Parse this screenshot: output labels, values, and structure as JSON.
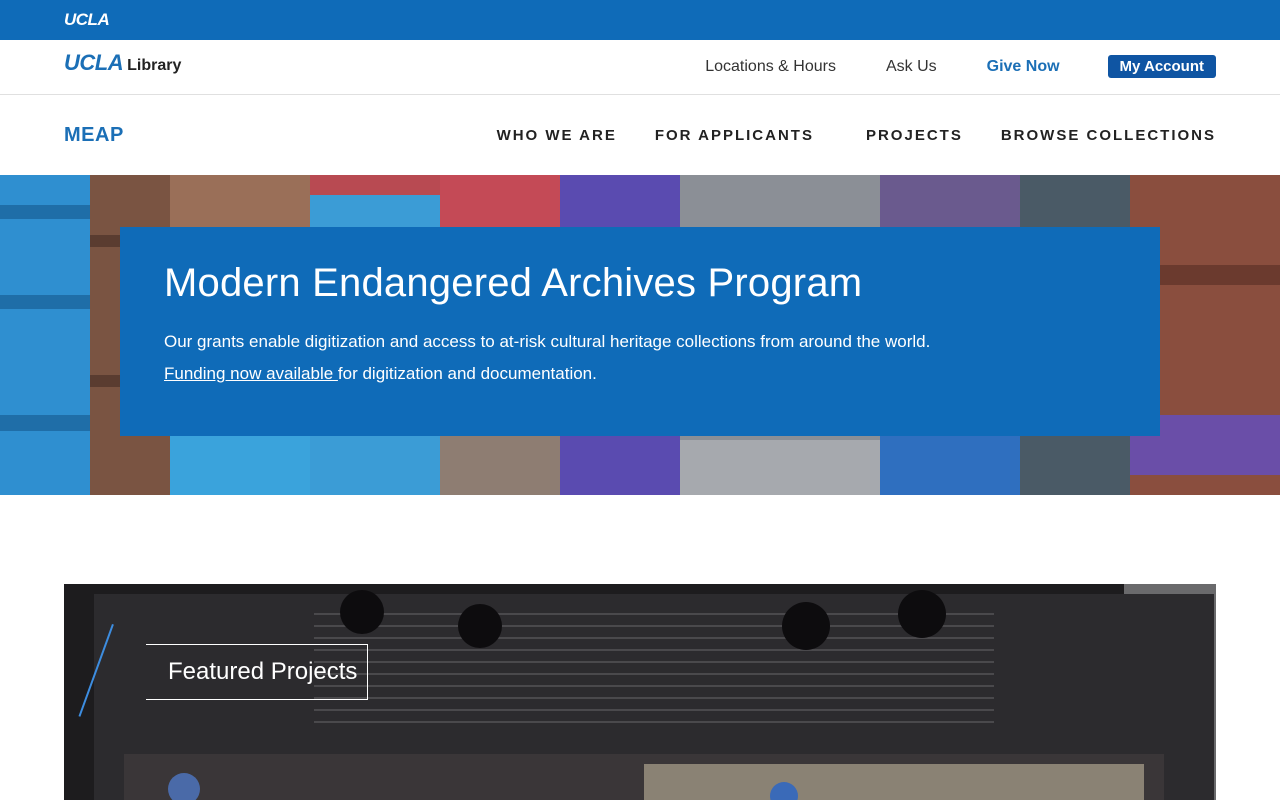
{
  "ucla_bar": {
    "brand": "UCLA"
  },
  "library_header": {
    "logo_ucla": "UCLA",
    "logo_library": "Library",
    "links": [
      "Locations & Hours",
      "Ask Us",
      "Give Now"
    ],
    "account_label": "My Account"
  },
  "site_header": {
    "title": "MEAP",
    "nav": [
      "WHO WE ARE",
      "FOR APPLICANTS",
      "PROJECTS",
      "BROWSE COLLECTIONS"
    ]
  },
  "hero": {
    "heading": "Modern Endangered Archives Program",
    "description": "Our grants enable digitization and access to at-risk cultural heritage collections from around the world.",
    "funding_link": "Funding now available ",
    "funding_suffix": "for digitization and documentation."
  },
  "featured": {
    "label": "Featured Projects"
  },
  "colors": {
    "primary_blue": "#0f6bb8",
    "account_blue": "#0f55a3",
    "link_blue": "#1b6fb6"
  }
}
